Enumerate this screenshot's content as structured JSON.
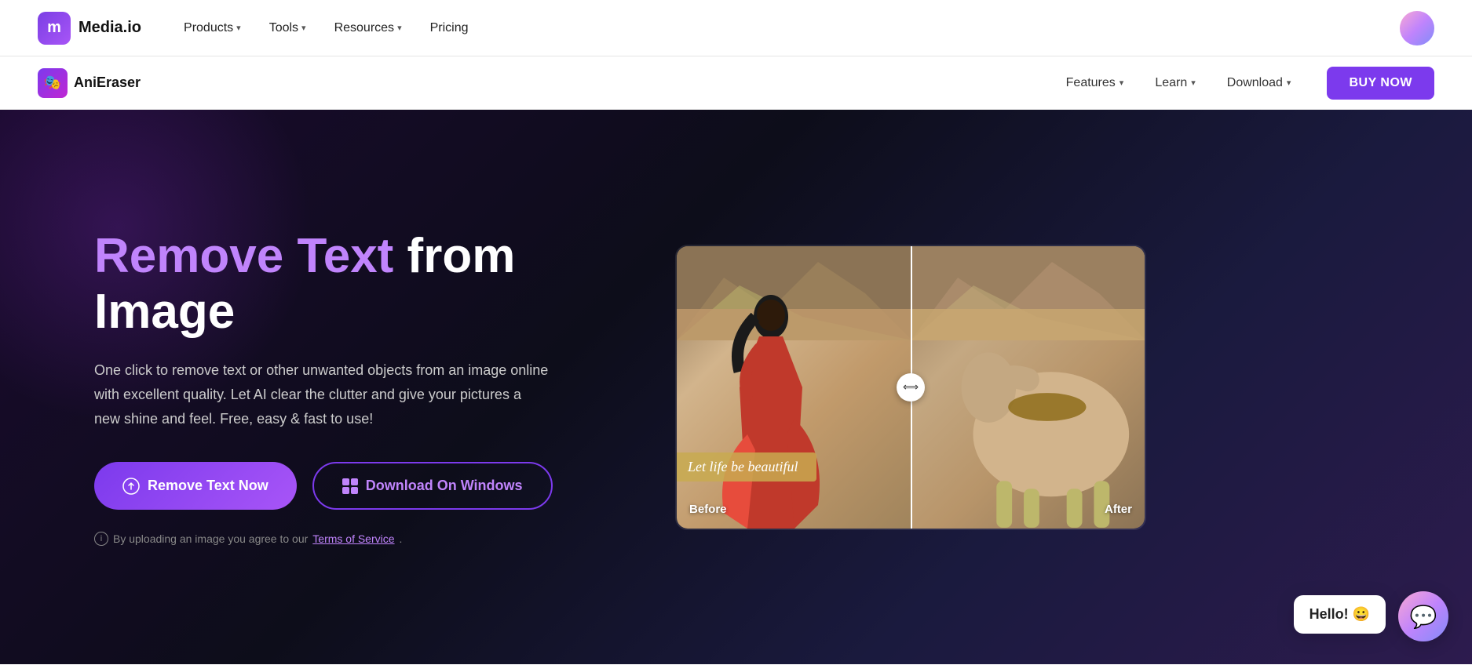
{
  "top_nav": {
    "logo_icon": "m",
    "logo_text": "Media.io",
    "items": [
      {
        "label": "Products",
        "has_chevron": true
      },
      {
        "label": "Tools",
        "has_chevron": true
      },
      {
        "label": "Resources",
        "has_chevron": true
      },
      {
        "label": "Pricing",
        "has_chevron": false
      }
    ]
  },
  "secondary_nav": {
    "app_icon": "🎭",
    "app_name": "AniEraser",
    "items": [
      {
        "label": "Features",
        "has_chevron": true
      },
      {
        "label": "Learn",
        "has_chevron": true
      },
      {
        "label": "Download",
        "has_chevron": true
      }
    ],
    "buy_button": "BUY NOW"
  },
  "hero": {
    "title_purple": "Remove Text",
    "title_suffix": " from",
    "title_line2": "Image",
    "description": "One click to remove text or other unwanted objects from an image online with excellent quality. Let AI clear the clutter and give your pictures a new shine and feel. Free, easy & fast to use!",
    "btn_remove": "Remove Text Now",
    "btn_windows": "Download On Windows",
    "terms_text": "By uploading an image you agree to our",
    "terms_link": "Terms of Service",
    "before_label": "Before",
    "after_label": "After",
    "text_overlay": "Let life be beautiful"
  },
  "chat": {
    "hello_text": "Hello! 😀",
    "icon": "💬"
  }
}
